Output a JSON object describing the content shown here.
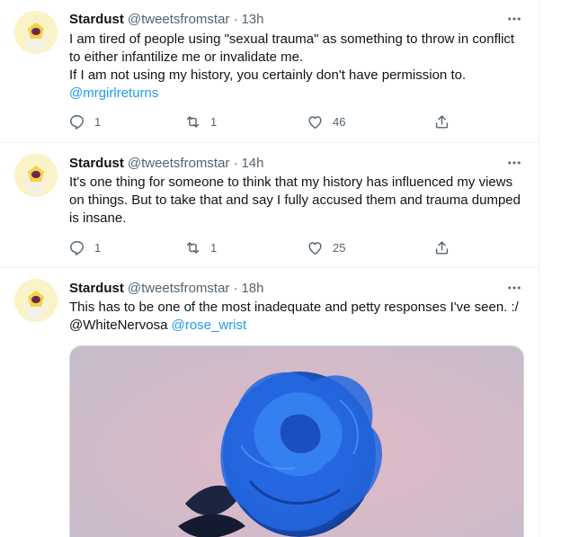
{
  "tweets": [
    {
      "name": "Stardust",
      "handle": "@tweetsfromstar",
      "dot": "·",
      "time": "13h",
      "lines": [
        "I am tired of people using \"sexual trauma\" as something to throw in conflict",
        "to either infantilize me or invalidate me.",
        "If I am not using my history, you certainly don't have permission to."
      ],
      "mention": "@mrgirlreturns",
      "replies": "1",
      "retweets": "1",
      "likes": "46"
    },
    {
      "name": "Stardust",
      "handle": "@tweetsfromstar",
      "dot": "·",
      "time": "14h",
      "lines": [
        "It's one thing for someone to think that my history has influenced my views",
        "on things. But to take that and say I fully accused them and trauma dumped",
        "is insane."
      ],
      "replies": "1",
      "retweets": "1",
      "likes": "25"
    },
    {
      "name": "Stardust",
      "handle": "@tweetsfromstar",
      "dot": "·",
      "time": "18h",
      "lines": [
        "This has to be one of the most inadequate and petty responses I've seen. :/"
      ],
      "mention_plain": "@WhiteNervosa",
      "mention": "@rose_wrist",
      "media_alt": "blue rose photo"
    }
  ],
  "icons": {
    "reply": "reply-icon",
    "retweet": "retweet-icon",
    "like": "heart-icon",
    "share": "share-icon",
    "more": "more-icon"
  },
  "colors": {
    "text": "#0f1419",
    "secondary": "#536471",
    "link": "#1d9bf0",
    "border": "#eff3f4",
    "rose": "#1f5fd6"
  }
}
